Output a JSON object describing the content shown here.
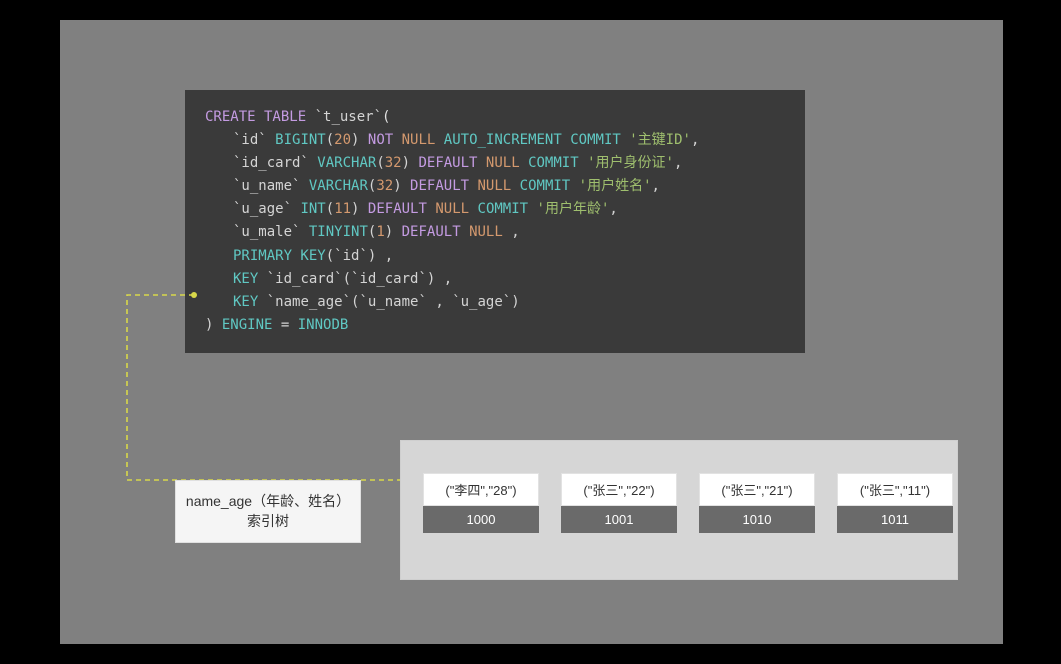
{
  "sql": {
    "l1_create": "CREATE TABLE",
    "l1_tbl": "`t_user`",
    "l1_open": "(",
    "cols": {
      "id": {
        "name": "`id`",
        "type": "BIGINT",
        "len": "20",
        "notnull": "NOT",
        "null": "NULL",
        "auto": "AUTO_INCREMENT",
        "commit": "COMMIT",
        "comment": "'主键ID'"
      },
      "idcard": {
        "name": "`id_card`",
        "type": "VARCHAR",
        "len": "32",
        "default": "DEFAULT",
        "null": "NULL",
        "commit": "COMMIT",
        "comment": "'用户身份证'"
      },
      "uname": {
        "name": "`u_name`",
        "type": "VARCHAR",
        "len": "32",
        "default": "DEFAULT",
        "null": "NULL",
        "commit": "COMMIT",
        "comment": "'用户姓名'"
      },
      "uage": {
        "name": "`u_age`",
        "type": "INT",
        "len": "11",
        "default": "DEFAULT",
        "null": "NULL",
        "commit": "COMMIT",
        "comment": "'用户年龄'"
      },
      "umale": {
        "name": "`u_male`",
        "type": "TINYINT",
        "len": "1",
        "default": "DEFAULT",
        "null": "NULL"
      }
    },
    "pk": {
      "kw": "PRIMARY KEY",
      "col": "`id`"
    },
    "key1": {
      "kw": "KEY",
      "name": "`id_card`",
      "col": "`id_card`"
    },
    "key2": {
      "kw": "KEY",
      "name": "`name_age`",
      "col1": "`u_name`",
      "col2": "`u_age`"
    },
    "engine_kw": "ENGINE",
    "engine_eq": "=",
    "engine_val": "INNODB"
  },
  "label": {
    "line1": "name_age（年龄、姓名）",
    "line2": "索引树"
  },
  "tree": {
    "nodes": [
      {
        "key": "(\"李四\",\"28\")",
        "ptr": "1000"
      },
      {
        "key": "(\"张三\",\"22\")",
        "ptr": "1001"
      },
      {
        "key": "(\"张三\",\"21\")",
        "ptr": "1010"
      },
      {
        "key": "(\"张三\",\"11\")",
        "ptr": "1011"
      }
    ]
  }
}
